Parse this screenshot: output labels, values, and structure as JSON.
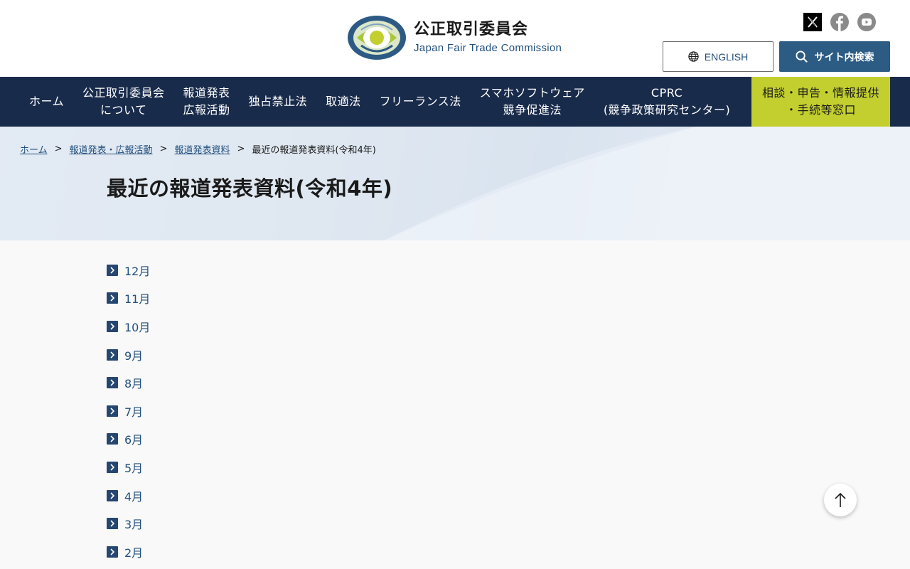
{
  "header": {
    "logo_title": "公正取引委員会",
    "logo_subtitle": "Japan Fair Trade Commission",
    "emblem_text": "JAPAN FAIR TRADE COMMISSION",
    "social": [
      "x-icon",
      "facebook-icon",
      "youtube-icon"
    ],
    "english_label": "ENGLISH",
    "search_label": "サイト内検索"
  },
  "nav": {
    "items": [
      {
        "label": "ホーム"
      },
      {
        "label": "公正取引委員会\nについて"
      },
      {
        "label": "報道発表\n広報活動"
      },
      {
        "label": "独占禁止法"
      },
      {
        "label": "取適法"
      },
      {
        "label": "フリーランス法"
      },
      {
        "label": "スマホソフトウェア\n競争促進法"
      },
      {
        "label": "CPRC\n(競争政策研究センター)"
      }
    ],
    "cta_label": "相談・申告・情報提供\n・手続等窓口"
  },
  "breadcrumb": {
    "items": [
      "ホーム",
      "報道発表・広報活動",
      "報道発表資料"
    ],
    "separator": ">",
    "current": "最近の報道発表資料(令和4年)"
  },
  "page": {
    "title": "最近の報道発表資料(令和4年)"
  },
  "months": [
    "12月",
    "11月",
    "10月",
    "9月",
    "8月",
    "7月",
    "6月",
    "5月",
    "4月",
    "3月",
    "2月"
  ],
  "colors": {
    "nav_bg": "#192b4b",
    "cta_bg": "#c3cf2f",
    "link": "#23507d",
    "search_bg": "#2c5b84"
  },
  "icons": {
    "chevron": "chevron-right-icon",
    "to_top": "arrow-up-icon",
    "globe": "globe-icon",
    "search": "search-icon"
  }
}
